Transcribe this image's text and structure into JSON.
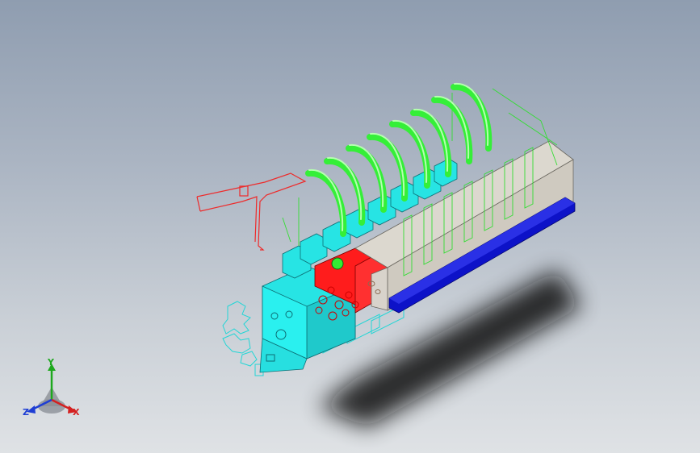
{
  "viewport": {
    "colors": {
      "background_top": "#8f9db0",
      "background_bottom": "#dfe2e5",
      "block_gray": "#d9d6cd",
      "end_plate_red": "#ff1b1b",
      "base_rail_blue": "#0d12c8",
      "clamp_arms_green": "#39f23a",
      "valves_cyan": "#26e5e5",
      "sketch_red": "#ee2a2a",
      "wire_green": "#33dd33",
      "wire_cyan": "#22d6d6"
    },
    "icons": {
      "triad": "xyz-triad-icon"
    }
  },
  "triad": {
    "y_label": "Y",
    "x_label": "X",
    "z_label": "Z"
  }
}
